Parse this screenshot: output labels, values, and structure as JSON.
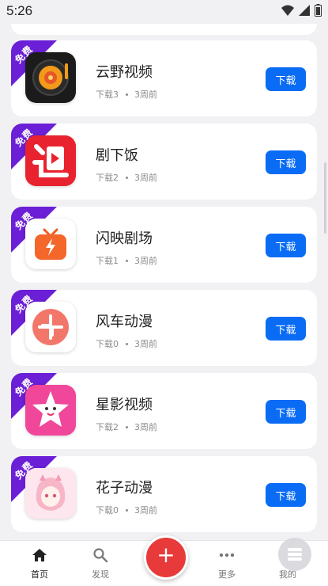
{
  "status_bar": {
    "time": "5:26"
  },
  "ribbon_label": "免费",
  "download_label": "下载",
  "apps": [
    {
      "name": "云野视频",
      "downloads": "下载3",
      "age": "3周前",
      "icon": "vinyl-record-icon"
    },
    {
      "name": "剧下饭",
      "downloads": "下载2",
      "age": "3周前",
      "icon": "red-chase-logo-icon"
    },
    {
      "name": "闪映剧场",
      "downloads": "下载1",
      "age": "3周前",
      "icon": "tv-lightning-icon"
    },
    {
      "name": "风车动漫",
      "downloads": "下载0",
      "age": "3周前",
      "icon": "pinwheel-icon"
    },
    {
      "name": "星影视频",
      "downloads": "下载2",
      "age": "3周前",
      "icon": "pink-star-icon"
    },
    {
      "name": "花子动漫",
      "downloads": "下载0",
      "age": "3周前",
      "icon": "anime-girl-icon"
    }
  ],
  "bottom_nav": {
    "home": "首页",
    "discover": "发现",
    "more": "更多",
    "mine": "我的",
    "fab_symbol": "+"
  },
  "colors": {
    "accent": "#0a6cf5",
    "ribbon": "#6b1fd6",
    "fab": "#e83a3a"
  }
}
